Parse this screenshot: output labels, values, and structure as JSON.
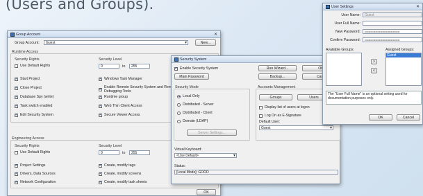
{
  "heading": "(Users and Groups).",
  "group_account_window": {
    "title": "Group Account",
    "close": "✕",
    "group_account_label": "Group Account:",
    "group_account_value": "Guest",
    "new_button": "New...",
    "runtime_access_label": "Runtime Access",
    "security_rights_label": "Security Rights",
    "use_default_rights_label": "Use Default Rights",
    "security_level_label": "Security Level",
    "level_from": "0",
    "level_to_label": "to",
    "level_to": "255",
    "runtime_left_checks": [
      {
        "label": "Start Project",
        "checked": true
      },
      {
        "label": "Close Project",
        "checked": true
      },
      {
        "label": "Database Spy (write)",
        "checked": true
      },
      {
        "label": "Task switch enabled",
        "checked": true
      },
      {
        "label": "Edit Security System",
        "checked": true
      }
    ],
    "runtime_right_checks": [
      {
        "label": "Windows Task Manager",
        "checked": true
      },
      {
        "label": "Enable Remote Security System and Remote Debugging Tools",
        "checked": true
      },
      {
        "label": "Runtime group",
        "checked": true
      },
      {
        "label": "Web Thin Client Access",
        "checked": true
      },
      {
        "label": "Secure Viewer Access",
        "checked": true
      }
    ],
    "engineering_access_label": "Engineering Access",
    "eng_security_rights_label": "Security Rights",
    "eng_use_default_rights_label": "Use Default Rights",
    "eng_security_level_label": "Security Level",
    "eng_level_from": "0",
    "eng_level_to_label": "to",
    "eng_level_to": "255",
    "eng_left_checks": [
      {
        "label": "Project Settings",
        "checked": true
      },
      {
        "label": "Drivers, Data Sources",
        "checked": true
      },
      {
        "label": "Network Configuration",
        "checked": true
      }
    ],
    "eng_right_checks": [
      {
        "label": "Create, modify tags",
        "checked": true
      },
      {
        "label": "Create, modify screens",
        "checked": true
      },
      {
        "label": "Create, modify task sheets",
        "checked": true
      }
    ]
  },
  "security_system_window": {
    "title": "Security System",
    "enable_label": "Enable Security System",
    "main_password_button": "Main Password",
    "security_mode_label": "Security Mode",
    "modes": [
      {
        "label": "Local Only",
        "selected": true
      },
      {
        "label": "Distributed - Server",
        "selected": false
      },
      {
        "label": "Distributed - Client",
        "selected": false
      },
      {
        "label": "Domain (LDAP)",
        "selected": false
      }
    ],
    "server_settings_button": "Server Settings...",
    "run_wizard_button": "Run Wizard...",
    "ok_top_button": "OK",
    "backup_button": "Backup...",
    "cancel_top_button": "Canc",
    "accounts_management_label": "Accounts Management",
    "groups_button": "Groups",
    "users_button": "Users",
    "display_list_label": "Display list of users at logon",
    "log_on_label": "Log On as E-Signature",
    "default_user_label": "Default User:",
    "default_user_value": "Guest",
    "virtual_keyboard_label": "Virtual Keyboard:",
    "virtual_keyboard_value": "<Use Default>",
    "status_label": "Status:",
    "status_value": "[Local Mode]: GOOD",
    "ok_bottom_button": "OK"
  },
  "group_account_behind_ok": "OK",
  "user_settings_window": {
    "title": "User Settings",
    "close": "✕",
    "user_name_label": "User Name:",
    "user_name_value": "Guest",
    "user_full_name_label": "User Full Name:",
    "user_full_name_value": "",
    "new_password_label": "New Password:",
    "new_password_value": "••••••••••••••••••••••••••••••••••••",
    "confirm_password_label": "Confirm Password:",
    "confirm_password_value": "••••••••••••••••••••••••••••••••••••",
    "available_groups_label": "Available Groups:",
    "assigned_groups_label": "Assigned Groups:",
    "assigned_groups": [
      "Guest"
    ],
    "add_arrow": ">",
    "remove_arrow": "<",
    "note": "The \"User Full Name\" is an optional setting used for documentation purposes only.",
    "ok_button": "OK",
    "cancel_button": "Cancel"
  },
  "colors": {
    "accent": "#3a7bd5",
    "title_bar": "#c9daee"
  }
}
